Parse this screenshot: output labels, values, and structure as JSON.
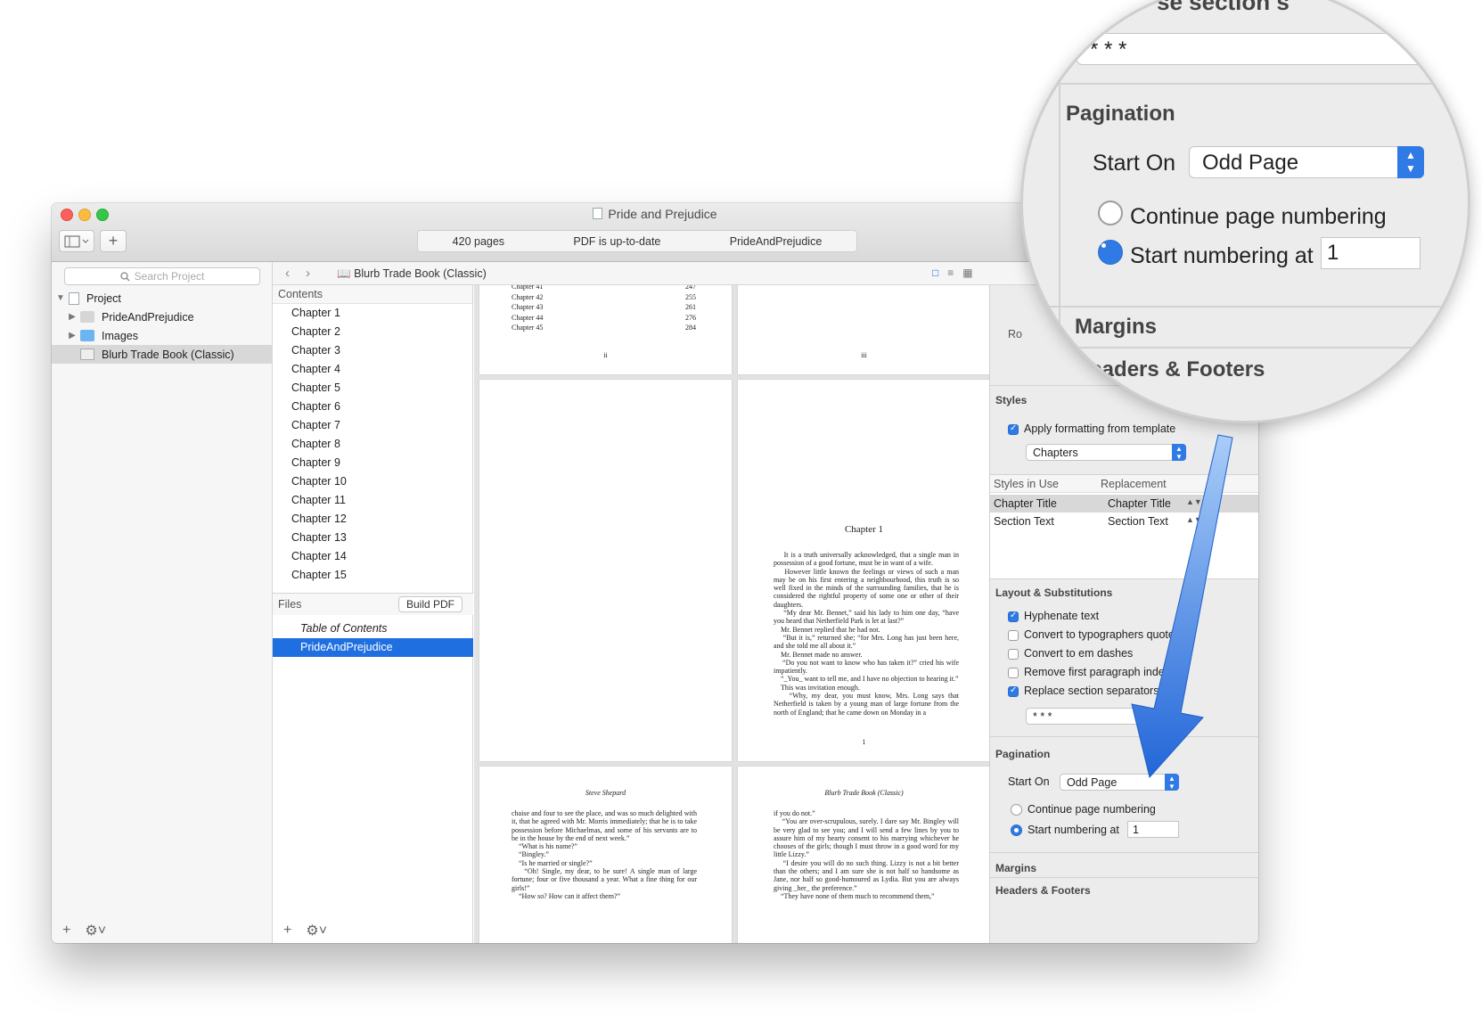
{
  "window": {
    "title": "Pride and Prejudice",
    "status": [
      "420 pages",
      "PDF is up-to-date",
      "PrideAndPrejudice"
    ],
    "add_label": "+"
  },
  "binder": {
    "search_placeholder": "Search Project",
    "items": [
      {
        "label": "Project"
      },
      {
        "label": "PrideAndPrejudice"
      },
      {
        "label": "Images"
      },
      {
        "label": "Blurb Trade Book (Classic)"
      }
    ]
  },
  "navbar": {
    "breadcrumb": "Blurb Trade Book (Classic)"
  },
  "contents": {
    "header": "Contents",
    "chapters": [
      "Chapter 1",
      "Chapter 2",
      "Chapter 3",
      "Chapter 4",
      "Chapter 5",
      "Chapter 6",
      "Chapter 7",
      "Chapter 8",
      "Chapter 9",
      "Chapter 10",
      "Chapter 11",
      "Chapter 12",
      "Chapter 13",
      "Chapter 14",
      "Chapter 15"
    ],
    "files_header": "Files",
    "build_button": "Build PDF",
    "files": [
      "Table of Contents",
      "PrideAndPrejudice"
    ]
  },
  "preview": {
    "toc": [
      {
        "title": "Chapter 41",
        "page": "247"
      },
      {
        "title": "Chapter 42",
        "page": "255"
      },
      {
        "title": "Chapter 43",
        "page": "261"
      },
      {
        "title": "Chapter 44",
        "page": "276"
      },
      {
        "title": "Chapter 45",
        "page": "284"
      }
    ],
    "page_ii": "ii",
    "page_iii": "iii",
    "chapter_title": "Chapter 1",
    "chapter_text": "    It is a truth universally acknowledged, that a single man in possession of a good fortune, must be in want of a wife.\n    However little known the feelings or views of such a man may be on his first entering a neighbourhood, this truth is so well fixed in the minds of the surrounding families, that he is considered the rightful property of some one or other of their daughters.\n    “My dear Mr. Bennet,” said his lady to him one day, “have you heard that Netherfield Park is let at last?”\n    Mr. Bennet replied that he had not.\n    “But it is,” returned she; “for Mrs. Long has just been here, and she told me all about it.”\n    Mr. Bennet made no answer.\n    “Do you not want to know who has taken it?” cried his wife impatiently.\n    “_You_ want to tell me, and I have no objection to hearing it.”\n    This was invitation enough.\n    “Why, my dear, you must know, Mrs. Long says that Netherfield is taken by a young man of large fortune from the north of England; that he came down on Monday in a",
    "page_1": "1",
    "left_runhead": "Steve Shepard",
    "right_runhead": "Blurb Trade Book (Classic)",
    "left_text": "chaise and four to see the place, and was so much delighted with it, that he agreed with Mr. Morris immediately; that he is to take possession before Michaelmas, and some of his servants are to be in the house by the end of next week.”\n    “What is his name?”\n    “Bingley.”\n    “Is he married or single?”\n    “Oh! Single, my dear, to be sure! A single man of large fortune; four or five thousand a year. What a fine thing for our girls!”\n    “How so? How can it affect them?”",
    "right_text": "if you do not.”\n    “You are over-scrupulous, surely. I dare say Mr. Bingley will be very glad to see you; and I will send a few lines by you to assure him of my hearty consent to his marrying whichever he chooses of the girls; though I must throw in a good word for my little Lizzy.”\n    “I desire you will do no such thing. Lizzy is not a bit better than the others; and I am sure she is not half so handsome as Jane, nor half so good-humoured as Lydia. But you are always giving _her_ the preference.”\n    “They have none of them much to recommend them,”"
  },
  "inspector": {
    "styles_title": "Styles",
    "apply_formatting": "Apply formatting from template",
    "template_select": "Chapters",
    "styles_col1": "Styles in Use",
    "styles_col2": "Replacement",
    "styles_rows": [
      {
        "style": "Chapter Title",
        "replacement": "Chapter Title"
      },
      {
        "style": "Section Text",
        "replacement": "Section Text"
      }
    ],
    "layout_title": "Layout & Substitutions",
    "options": [
      {
        "label": "Hyphenate text",
        "checked": true
      },
      {
        "label": "Convert to typographers quotes",
        "checked": false
      },
      {
        "label": "Convert to em dashes",
        "checked": false
      },
      {
        "label": "Remove first paragraph indent",
        "checked": false
      },
      {
        "label": "Replace section separators with",
        "checked": true
      }
    ],
    "separator_value": "* * *",
    "pagination_title": "Pagination",
    "start_on_label": "Start On",
    "start_on_value": "Odd Page",
    "continue_numbering": "Continue page numbering",
    "start_numbering_at": "Start numbering at",
    "start_number": "1",
    "margins_title": "Margins",
    "headers_footers_title": "Headers & Footers",
    "ro_fragment": "Ro"
  },
  "zoom": {
    "section_fragment": "se section s",
    "separator_value": "* * *",
    "pagination_title": "Pagination",
    "start_on_label": "Start On",
    "start_on_value": "Odd Page",
    "continue_numbering": "Continue page numbering",
    "start_numbering_at": "Start numbering at",
    "start_number": "1",
    "margins_title": "Margins",
    "headers_footers_title": "Headers & Footers"
  },
  "colors": {
    "accent": "#2f7ae5",
    "selection": "#1f6fe0",
    "arrow": "#3f8ef0"
  }
}
